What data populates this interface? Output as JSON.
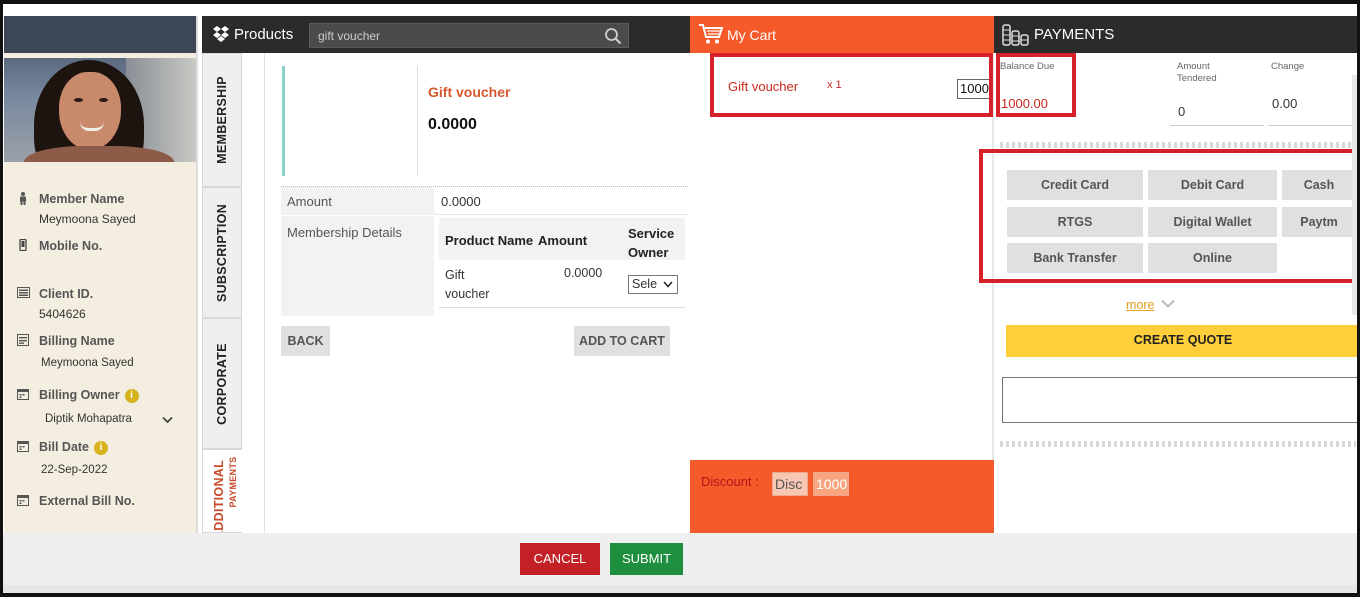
{
  "profile": {
    "member_name_label": "Member Name",
    "member_name": "Meymoona Sayed",
    "mobile_label": "Mobile No.",
    "client_id_label": "Client ID.",
    "client_id": "5404626",
    "billing_name_label": "Billing Name",
    "billing_name": "Meymoona  Sayed",
    "billing_owner_label": "Billing Owner",
    "billing_owner": "Diptik Mohapatra",
    "bill_date_label": "Bill Date",
    "bill_date": "22-Sep-2022",
    "external_bill_label": "External Bill No.",
    "info_badge": "i"
  },
  "products": {
    "title": "Products",
    "search_value": "gift voucher",
    "tabs": [
      "MEMBERSHIP",
      "SUBSCRIPTION",
      "CORPORATE",
      "ADDITIONAL",
      "PAYMENTS"
    ],
    "item_name": "Gift voucher",
    "item_price": "0.0000",
    "amount_label": "Amount",
    "amount_value": "0.0000",
    "membership_details_label": "Membership Details",
    "table_headers": [
      "Product Name",
      "Amount",
      "Service Owner"
    ],
    "table_row": {
      "product_name": "Gift voucher",
      "amount": "0.0000",
      "service_owner": "Sele"
    },
    "back_label": "BACK",
    "add_to_cart_label": "ADD TO CART"
  },
  "cart": {
    "title": "My Cart",
    "item_name": "Gift voucher",
    "item_qty": "x 1",
    "item_price": "1000",
    "discount_label": "Discount :",
    "discount_placeholder": "Disc",
    "discount_value": "1000"
  },
  "payments": {
    "title": "PAYMENTS",
    "balance_due_label": "Balance Due",
    "balance_due_value": "1000.00",
    "amount_tendered_label_1": "Amount",
    "amount_tendered_label_2": "Tendered",
    "amount_tendered_value": "0",
    "change_label": "Change",
    "change_value": "0.00",
    "methods": [
      "Credit Card",
      "Debit Card",
      "Cash",
      "RTGS",
      "Digital Wallet",
      "Paytm",
      "Bank Transfer",
      "Online"
    ],
    "more_label": "more",
    "create_quote_label": "CREATE QUOTE"
  },
  "footer": {
    "cancel_label": "CANCEL",
    "submit_label": "SUBMIT"
  },
  "colors": {
    "cart_orange": "#f45a2a",
    "highlight_red": "#d6212b",
    "cancel_red": "#c12127",
    "submit_green": "#1d8f3e",
    "quote_yellow": "#ffcf3b",
    "dark_header": "#2b2b2b"
  }
}
